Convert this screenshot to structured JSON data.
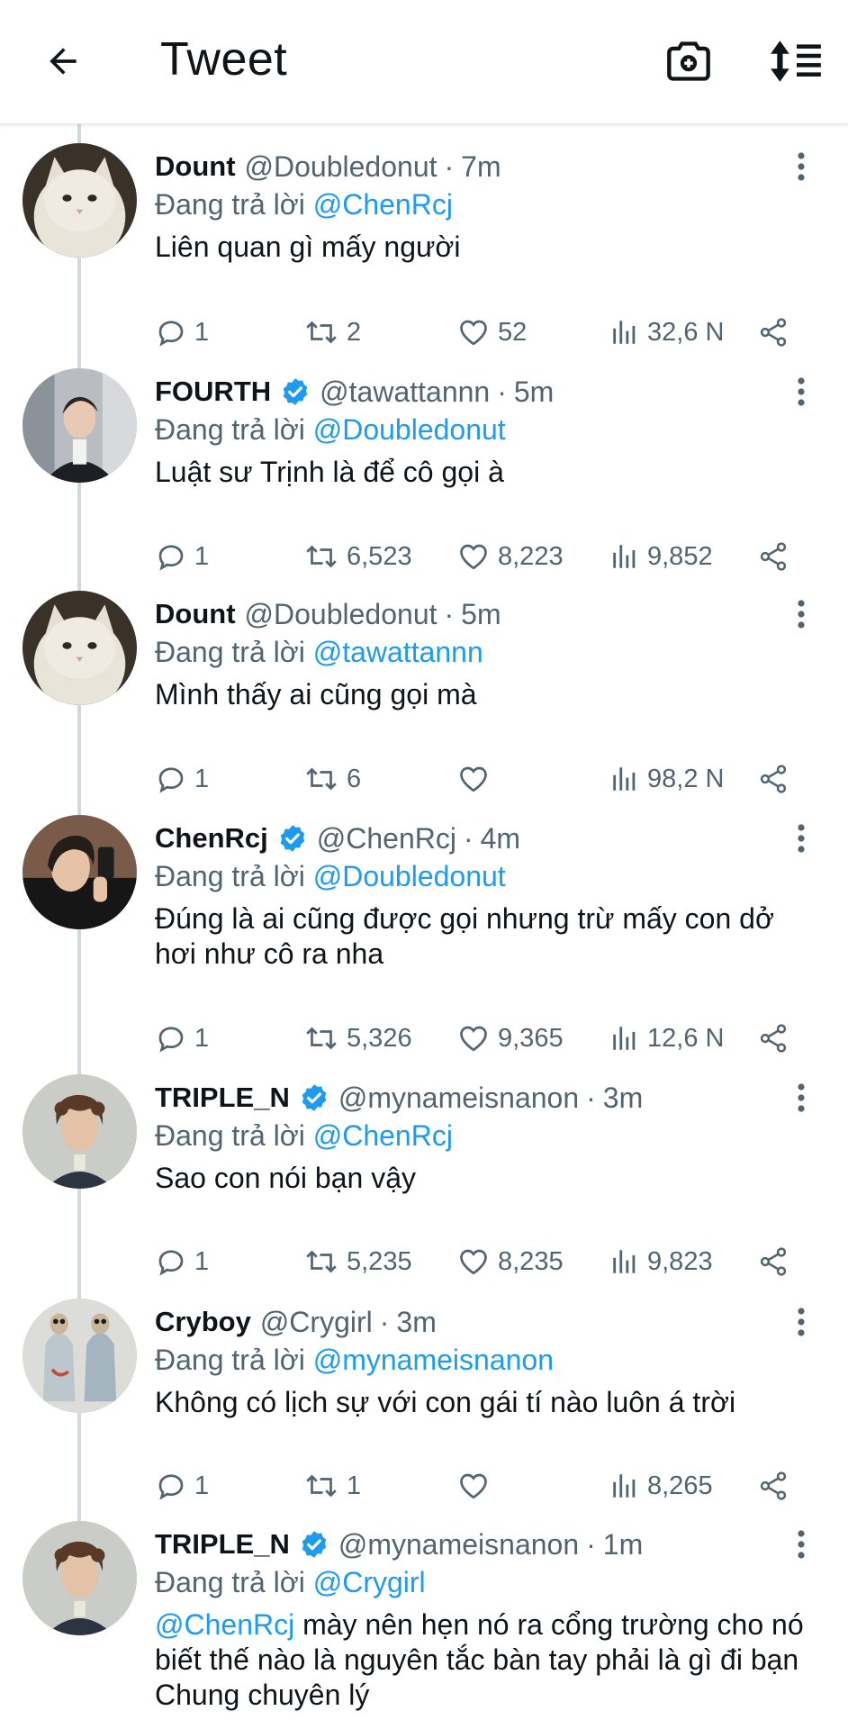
{
  "header": {
    "title": "Tweet"
  },
  "colors": {
    "accent": "#1d9bf0",
    "text": "#0f1419",
    "muted": "#536471",
    "thread_line": "#cfd9de"
  },
  "reply_prefix": "Đang trả lời",
  "tweets": [
    {
      "name": "Dount",
      "verified": false,
      "handle": "@Doubledonut",
      "time": "7m",
      "reply_to": "@ChenRcj",
      "text": "Liên quan gì mấy người",
      "replies": "1",
      "retweets": "2",
      "likes": "52",
      "views": "32,6 N",
      "avatar": "white-cat"
    },
    {
      "name": "FOURTH",
      "verified": true,
      "handle": "@tawattannn",
      "time": "5m",
      "reply_to": "@Doubledonut",
      "text": "Luật sư Trịnh là để cô gọi à",
      "replies": "1",
      "retweets": "6,523",
      "likes": "8,223",
      "views": "9,852",
      "avatar": "man-suit"
    },
    {
      "name": "Dount",
      "verified": false,
      "handle": "@Doubledonut",
      "time": "5m",
      "reply_to": "@tawattannn",
      "text": "Mình thấy ai cũng gọi mà",
      "replies": "1",
      "retweets": "6",
      "likes": "",
      "views": "98,2 N",
      "avatar": "white-cat"
    },
    {
      "name": "ChenRcj",
      "verified": true,
      "handle": "@ChenRcj",
      "time": "4m",
      "reply_to": "@Doubledonut",
      "text": "Đúng là ai cũng được gọi nhưng trừ mấy con dở hơi như cô ra nha",
      "replies": "1",
      "retweets": "5,326",
      "likes": "9,365",
      "views": "12,6 N",
      "avatar": "man-selfie"
    },
    {
      "name": "TRIPLE_N",
      "verified": true,
      "handle": "@mynameisnanon",
      "time": "3m",
      "reply_to": "@ChenRcj",
      "text": "Sao con nói bạn vậy",
      "replies": "1",
      "retweets": "5,235",
      "likes": "8,235",
      "views": "9,823",
      "avatar": "man-curly"
    },
    {
      "name": "Cryboy",
      "verified": false,
      "handle": "@Crygirl",
      "time": "3m",
      "reply_to": "@mynameisnanon",
      "text": "Không có lịch sự với con gái tí nào luôn á trời",
      "replies": "1",
      "retweets": "1",
      "likes": "",
      "views": "8,265",
      "avatar": "fish-bags"
    },
    {
      "name": "TRIPLE_N",
      "verified": true,
      "handle": "@mynameisnanon",
      "time": "1m",
      "reply_to": "@Crygirl",
      "mention": "@ChenRcj",
      "text": " mày nên hẹn nó ra cổng trường cho nó biết thế nào là nguyên tắc bàn tay phải là gì đi bạn Chung chuyên lý",
      "avatar": "man-curly"
    }
  ],
  "icons": {
    "back": "arrow-left-icon",
    "camera": "camera-plus-icon",
    "sort": "sort-icon",
    "more": "more-vertical-icon",
    "reply": "reply-bubble-icon",
    "retweet": "retweet-icon",
    "like": "heart-icon",
    "views": "views-chart-icon",
    "share": "share-icon",
    "verified": "verified-badge-icon"
  }
}
